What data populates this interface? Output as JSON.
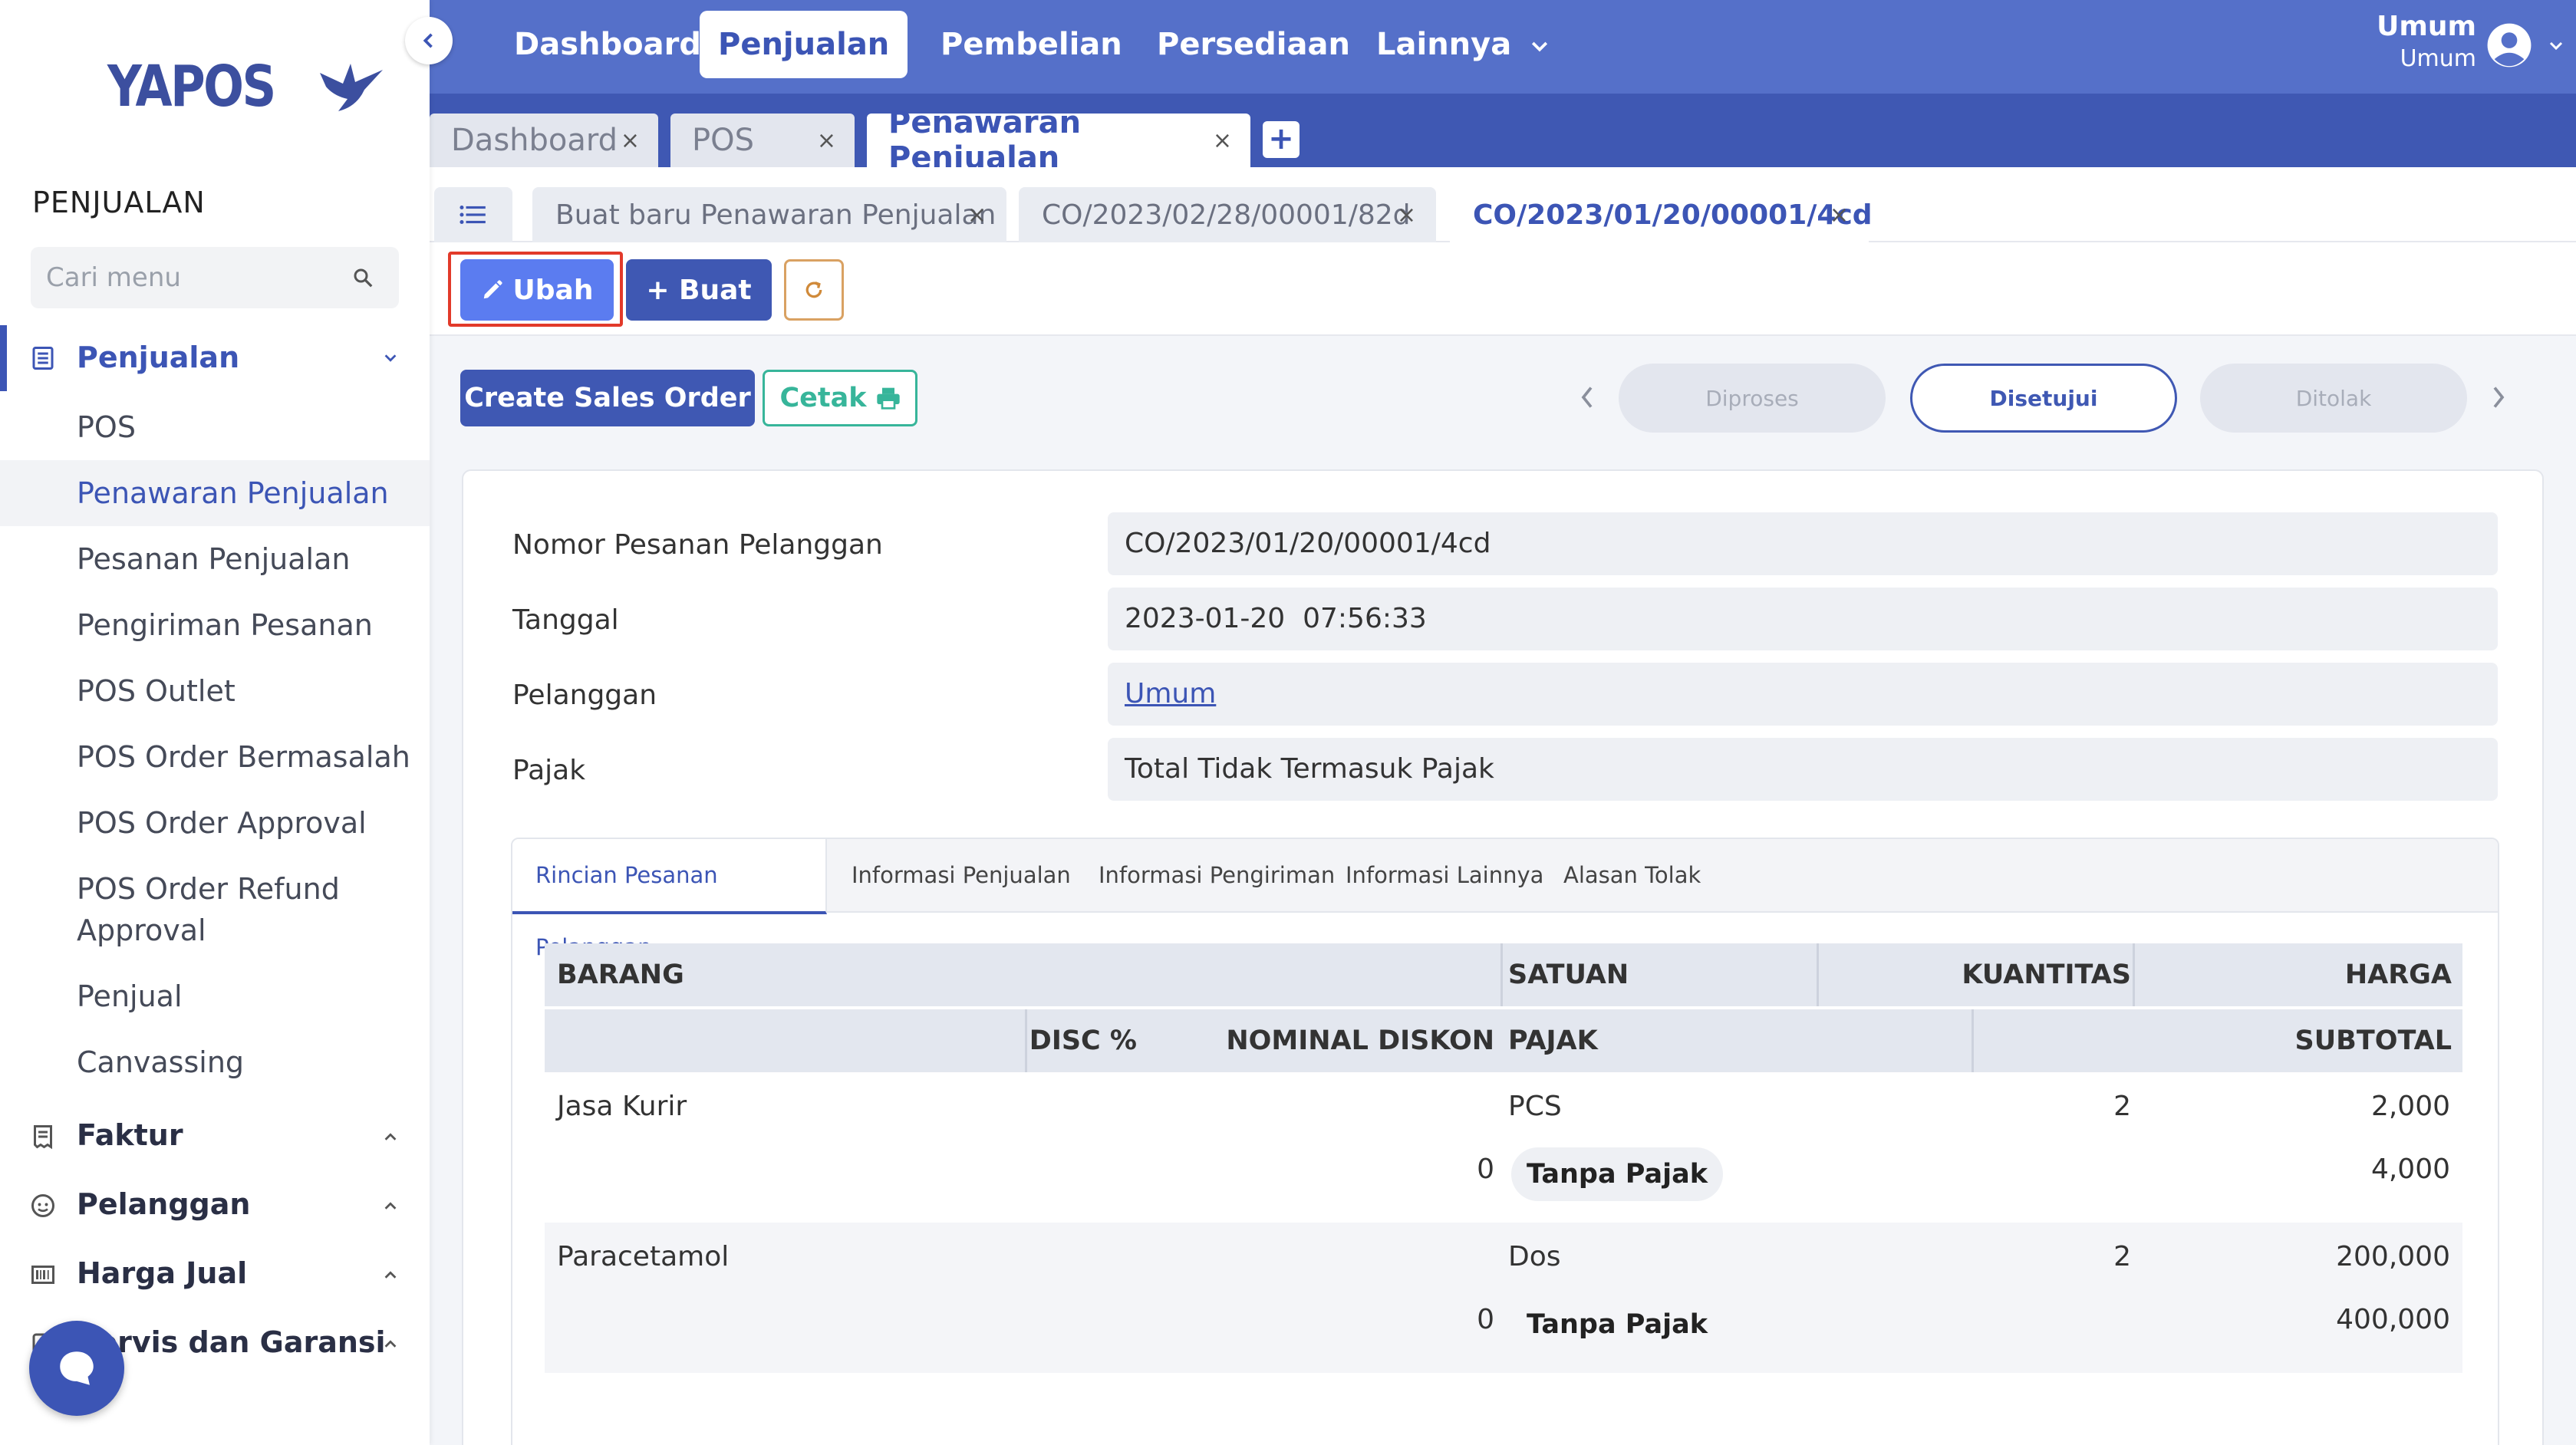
{
  "sidebar": {
    "logo_text": "YAPOS",
    "section_title": "PENJUALAN",
    "search_placeholder": "Cari menu",
    "groups": {
      "penjualan": "Penjualan",
      "faktur": "Faktur",
      "pelanggan": "Pelanggan",
      "harga_jual": "Harga Jual",
      "servis": "Servis dan Garansi"
    },
    "sub_items": [
      "POS",
      "Penawaran Penjualan",
      "Pesanan Penjualan",
      "Pengiriman Pesanan",
      "POS Outlet",
      "POS Order Bermasalah",
      "POS Order Approval",
      "POS Order Refund Approval",
      "Penjual",
      "Canvassing"
    ],
    "selected_sub_item": "Penawaran Penjualan"
  },
  "topbar": {
    "menus": [
      "Dashboard",
      "Penjualan",
      "Pembelian",
      "Persediaan",
      "Lainnya"
    ],
    "active_menu": "Penjualan",
    "user_name": "Umum",
    "user_role": "Umum"
  },
  "workspace_tabs": [
    {
      "label": "Dashboard",
      "close": "×"
    },
    {
      "label": "POS",
      "close": "×"
    },
    {
      "label": "Penawaran Penjualan",
      "close": "×"
    }
  ],
  "workspace_add": "+",
  "doc_tabs": [
    {
      "label": "Buat baru Penawaran Penjualan",
      "close": "×"
    },
    {
      "label": "CO/2023/02/28/00001/82d",
      "close": "×"
    },
    {
      "label": "CO/2023/01/20/00001/4cd",
      "close": "×"
    }
  ],
  "toolbar": {
    "ubah_label": "Ubah",
    "buat_label": "+ Buat"
  },
  "actions": {
    "create_sales_order": "Create Sales Order",
    "cetak": "Cetak"
  },
  "status_steps": [
    "Diproses",
    "Disetujui",
    "Ditolak"
  ],
  "current_status": "Disetujui",
  "form": {
    "nomor_label": "Nomor Pesanan Pelanggan",
    "nomor_value": "CO/2023/01/20/00001/4cd",
    "tanggal_label": "Tanggal",
    "tanggal_value": "2023-01-20  07:56:33",
    "pelanggan_label": "Pelanggan",
    "pelanggan_value": "Umum",
    "pajak_label": "Pajak",
    "pajak_value": "Total Tidak Termasuk Pajak"
  },
  "detail_tabs": [
    "Rincian Pesanan Pelanggan",
    "Informasi Penjualan",
    "Informasi Pengiriman",
    "Informasi Lainnya",
    "Alasan Tolak"
  ],
  "table": {
    "headers_row1": {
      "barang": "BARANG",
      "satuan": "SATUAN",
      "kuantitas": "KUANTITAS",
      "harga": "HARGA"
    },
    "headers_row2": {
      "disc": "DISC %",
      "nominal": "NOMINAL DISKON",
      "pajak": "PAJAK",
      "subtotal": "SUBTOTAL"
    },
    "rows": [
      {
        "barang": "Jasa Kurir",
        "satuan": "PCS",
        "kuantitas": "2",
        "harga": "2,000",
        "disc": "0",
        "pajak": "Tanpa Pajak",
        "subtotal": "4,000"
      },
      {
        "barang": "Paracetamol",
        "satuan": "Dos",
        "kuantitas": "2",
        "harga": "200,000",
        "disc": "0",
        "pajak": "Tanpa Pajak",
        "subtotal": "400,000"
      }
    ]
  },
  "colors": {
    "primary": "#3f58b3",
    "topbar": "#5570c9",
    "accent_blue": "#5b7cf0",
    "green": "#37b59a",
    "highlight": "#e23a2a"
  }
}
